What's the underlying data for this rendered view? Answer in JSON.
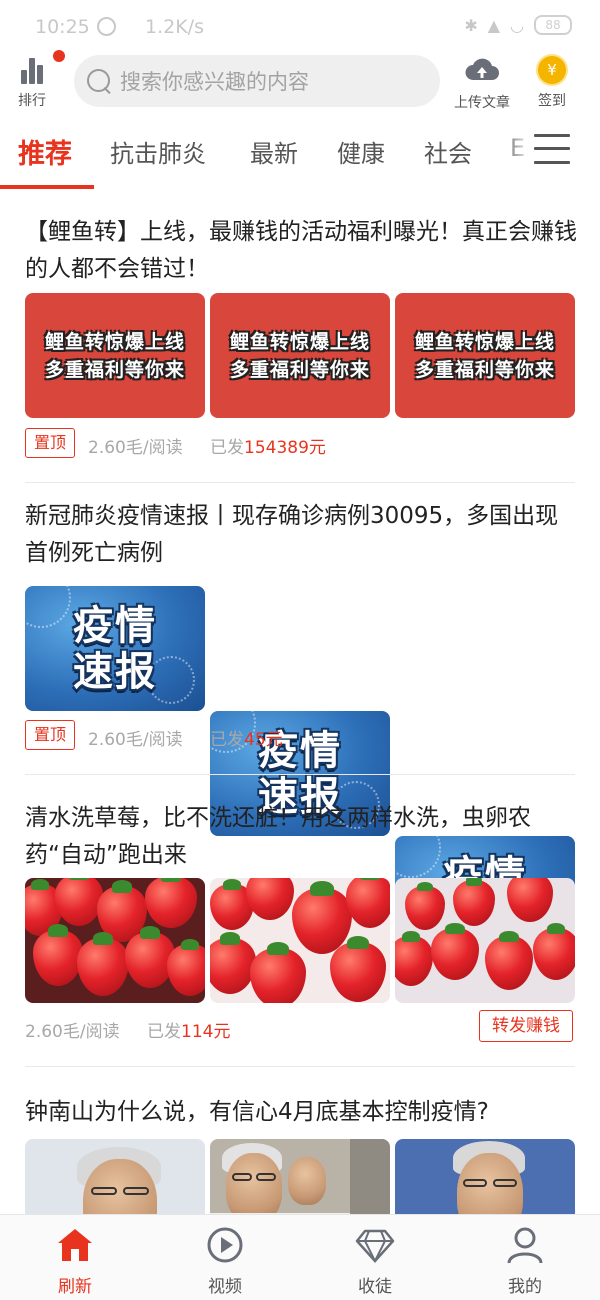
{
  "status_bar": {
    "time": "10:25",
    "speed": "1.2K/s",
    "battery": "88"
  },
  "header": {
    "rank_label": "排行",
    "search_placeholder": "搜索你感兴趣的内容",
    "upload_label": "上传文章",
    "signin_label": "签到",
    "coin_symbol": "¥"
  },
  "tabs": [
    {
      "label": "推荐",
      "active": true
    },
    {
      "label": "抗击肺炎"
    },
    {
      "label": "最新"
    },
    {
      "label": "健康"
    },
    {
      "label": "社会"
    },
    {
      "label": "E"
    }
  ],
  "articles": [
    {
      "title": "【鲤鱼转】上线，最赚钱的活动福利曝光！真正会赚钱的人都不会错过！",
      "thumb_text": [
        "鲤鱼转惊爆上线",
        "多重福利等你来"
      ],
      "pinned_label": "置顶",
      "rate": "2.60毛/阅读",
      "sent_prefix": "已发",
      "sent_amount": "154389元"
    },
    {
      "title": "新冠肺炎疫情速报丨现存确诊病例30095，多国出现首例死亡病例",
      "thumb_text": [
        "疫情",
        "速报"
      ],
      "pinned_label": "置顶",
      "rate": "2.60毛/阅读",
      "sent_prefix": "已发",
      "sent_amount": "45元"
    },
    {
      "title": "清水洗草莓，比不洗还脏！用这两样水洗，虫卵农药“自动”跑出来",
      "rate": "2.60毛/阅读",
      "sent_prefix": "已发",
      "sent_amount": "114元",
      "share_label": "转发赚钱"
    },
    {
      "title": "钟南山为什么说，有信心4月底基本控制疫情?"
    }
  ],
  "bottom_nav": [
    {
      "label": "刷新",
      "icon": "home-icon",
      "active": true
    },
    {
      "label": "视频",
      "icon": "play-icon"
    },
    {
      "label": "收徒",
      "icon": "diamond-icon"
    },
    {
      "label": "我的",
      "icon": "user-icon"
    }
  ],
  "colors": {
    "accent": "#e8341f",
    "promo_red": "#d9463b",
    "epi_blue": "#2d6fb8"
  }
}
